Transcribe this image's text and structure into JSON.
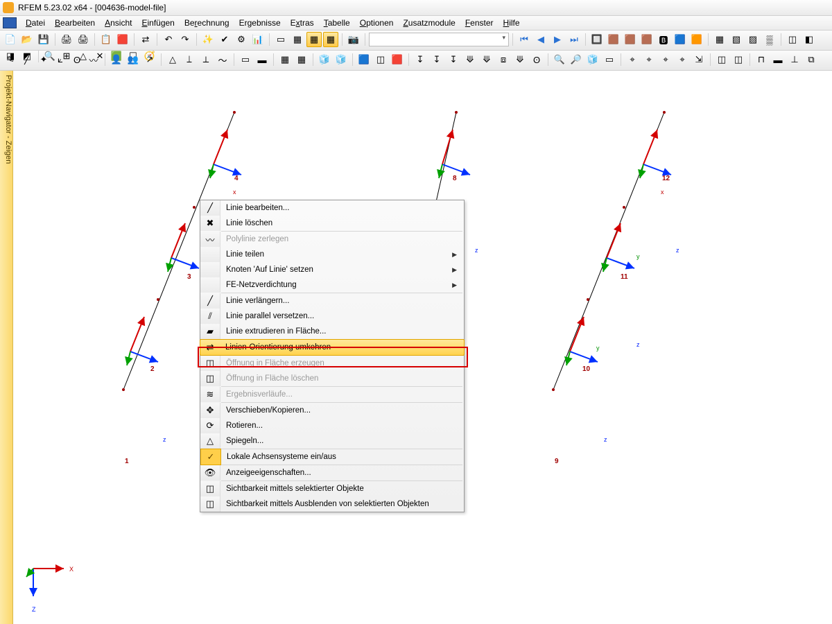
{
  "title": "RFEM 5.23.02 x64 - [004636-model-file]",
  "menus": [
    "Datei",
    "Bearbeiten",
    "Ansicht",
    "Einfügen",
    "Berechnung",
    "Ergebnisse",
    "Extras",
    "Tabelle",
    "Optionen",
    "Zusatzmodule",
    "Fenster",
    "Hilfe"
  ],
  "sidebar_label": "Projekt-Navigator - Zeigen",
  "nodes": {
    "n1": "1",
    "n2": "2",
    "n3": "3",
    "n4": "4",
    "n8": "8",
    "n9": "9",
    "n10": "10",
    "n11": "11",
    "n12": "12"
  },
  "axis": {
    "x": "X",
    "y": "y",
    "z": "Z",
    "xl": "x",
    "zl": "z"
  },
  "ctx": {
    "edit": "Linie bearbeiten...",
    "del": "Linie löschen",
    "poly": "Polylinie zerlegen",
    "split": "Linie teilen",
    "node": "Knoten 'Auf Linie' setzen",
    "fe": "FE-Netzverdichtung",
    "ext": "Linie verlängern...",
    "par": "Linie parallel versetzen...",
    "extr": "Linie extrudieren in Fläche...",
    "rev": "Linien-Orientierung umkehren",
    "open": "Öffnung in Fläche erzeugen",
    "opend": "Öffnung in Fläche löschen",
    "res": "Ergebnisverläufe...",
    "move": "Verschieben/Kopieren...",
    "rot": "Rotieren...",
    "mir": "Spiegeln...",
    "lax": "Lokale Achsensysteme ein/aus",
    "disp": "Anzeigeeigenschaften...",
    "vis1": "Sichtbarkeit mittels selektierter Objekte",
    "vis2": "Sichtbarkeit mittels Ausblenden von selektierten Objekten"
  }
}
